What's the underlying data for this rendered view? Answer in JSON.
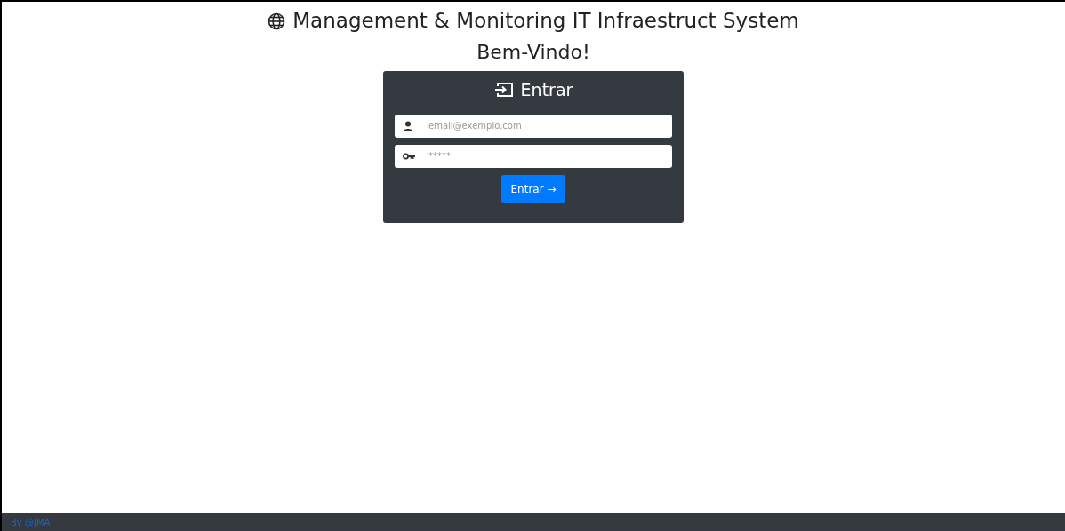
{
  "header": {
    "title": "Management & Monitoring IT Infraestruct System",
    "subtitle": "Bem-Vindo!"
  },
  "login": {
    "title": "Entrar",
    "fields": [
      {
        "kind": "email",
        "placeholder": "email@exemplo.com"
      },
      {
        "kind": "password",
        "placeholder": "*****"
      }
    ],
    "button": "Entrar →"
  },
  "footer": {
    "text": "By @JMA"
  }
}
